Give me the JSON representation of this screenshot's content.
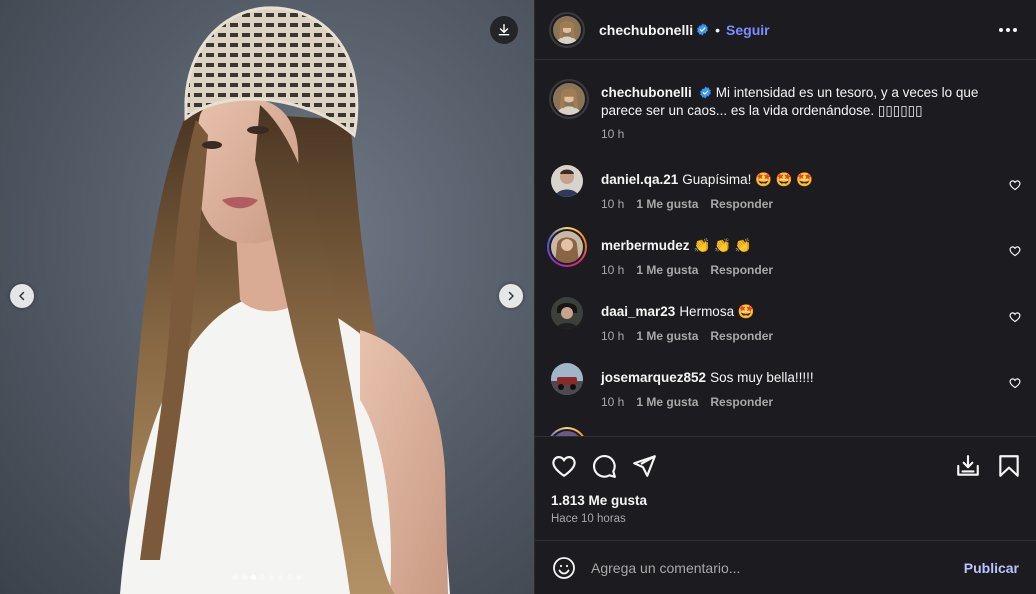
{
  "media": {
    "download_icon": "download-icon",
    "prev_icon": "chevron-left-icon",
    "next_icon": "chevron-right-icon",
    "carousel": {
      "count": 8,
      "active_index": 2
    }
  },
  "header": {
    "username": "chechubonelli",
    "follow_label": "Seguir",
    "separator": "•"
  },
  "caption": {
    "username": "chechubonelli",
    "text": "Mi intensidad es un tesoro, y a veces lo que parece ser un caos... es la vida ordenándose. ▯▯▯▯▯▯",
    "time": "10 h"
  },
  "comments": [
    {
      "username": "daniel.qa.21",
      "text": "Guapísima! 🤩 🤩 🤩",
      "time": "10 h",
      "likes": "1 Me gusta",
      "reply": "Responder"
    },
    {
      "username": "merbermudez",
      "text": "👏 👏 👏",
      "time": "10 h",
      "likes": "1 Me gusta",
      "reply": "Responder"
    },
    {
      "username": "daai_mar23",
      "text": "Hermosa 🤩",
      "time": "10 h",
      "likes": "1 Me gusta",
      "reply": "Responder"
    },
    {
      "username": "josemarquez852",
      "text": "Sos muy bella!!!!!",
      "time": "10 h",
      "likes": "1 Me gusta",
      "reply": "Responder"
    }
  ],
  "stats": {
    "likes": "1.813 Me gusta",
    "posted": "Hace 10 horas"
  },
  "composer": {
    "placeholder": "Agrega un comentario...",
    "publish_label": "Publicar"
  },
  "colors": {
    "panel_bg": "#1c1c20",
    "accent_blue": "#7d8cff",
    "verified": "#3897f0",
    "muted": "#a8a8a8"
  }
}
